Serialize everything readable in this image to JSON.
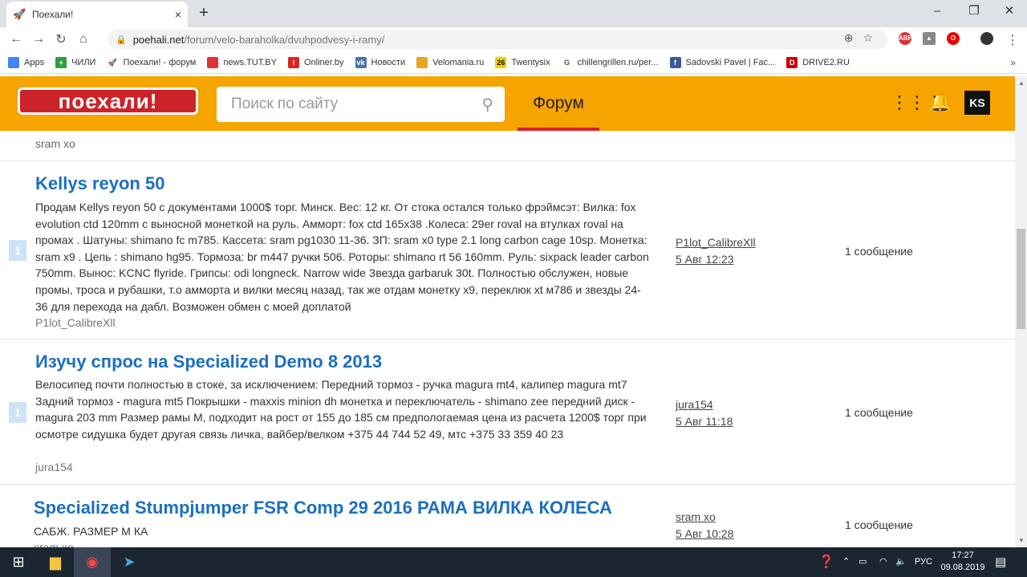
{
  "browser": {
    "tab_title": "Поехали!",
    "tab_close": "×",
    "new_tab": "+",
    "url_domain": "poehali.net",
    "url_path": "/forum/velo-baraholka/dvuhpodvesy-i-ramy/",
    "window_controls": [
      "–",
      "❐",
      "✕"
    ]
  },
  "bookmarks": {
    "items": [
      {
        "label": "Apps",
        "color": "#4285f4",
        "icon": "apps-grid-icon"
      },
      {
        "label": "ЧИЛИ",
        "color": "#2e9e3e",
        "icon": "plus-icon"
      },
      {
        "label": "Поехали! - форум",
        "color": "#e33",
        "icon": "rocket-icon"
      },
      {
        "label": "news.TUT.BY",
        "color": "#d33",
        "icon": "tutby-icon"
      },
      {
        "label": "Onliner.by",
        "color": "#d22",
        "icon": "onliner-icon"
      },
      {
        "label": "Новости",
        "color": "#4a76a8",
        "icon": "vk-icon"
      },
      {
        "label": "Velomania.ru",
        "color": "#e5a622",
        "icon": "velomania-icon"
      },
      {
        "label": "Twentysix",
        "color": "#111",
        "icon": "twentysix-icon"
      },
      {
        "label": "chillengrillen.ru/per...",
        "color": "#555",
        "icon": "chillengrillen-icon"
      },
      {
        "label": "Sadovski Pavel | Fac...",
        "color": "#3b5998",
        "icon": "facebook-icon"
      },
      {
        "label": "DRIVE2.RU",
        "color": "#c00",
        "icon": "drive2-icon"
      }
    ],
    "more": "»"
  },
  "site": {
    "logo": "поехали!",
    "search_placeholder": "Поиск по сайту",
    "forum_tab": "Форум",
    "accent": "#f5a400"
  },
  "content": {
    "prev_author_tail": "sram xo",
    "topics": [
      {
        "title": "Kellys reyon 50",
        "description": "Продам Kellys reyon 50 с документами 1000$ торг. Минск. Вес: 12 кг. От стока остался только фрэймсэт: Вилка: fox evolution ctd 120mm с выносной монеткой на руль. Амморт: fox ctd 165x38 .Колеса: 29er roval на втулках roval на промах . Шатуны: shimano fc m785. Кассета: sram pg1030 11-36. ЗП: sram x0 type 2.1 long carbon cage 10sp. Монетка: sram x9 . Цепь : shimano hg95. Тормоза: br m447 ручки 506. Роторы: shimano rt 56 160mm. Руль: sixpack leader carbon 750mm. Вынос: KCNC flyride. Грипсы: odi longneck. Narrow wide Звезда garbaruk 30t. Полностью обслужен, новые промы, троса и рубашки, т.о амморта и вилки месяц назад, так же отдам монетку x9, переклюк xt м786 и звезды 24-36 для перехода на дабл. Возможен обмен с моей доплатой",
        "author": "P1lot_CalibreXll",
        "badge": "1",
        "last_author": "P1lot_CalibreXll",
        "last_date": "5 Авг 12:23",
        "count": "1 сообщение"
      },
      {
        "title": "Изучу спрос на Specialized Demo 8 2013",
        "description": "Велосипед почти полностью в стоке, за исключением: Передний тормоз - ручка magura mt4, калипер magura mt7 Задний тормоз - magura mt5 Покрышки - maxxis minion dh монетка и переключатель - shimano zee передний диск - magura 203 mm Размер рамы М, подходит на рост от 155 до 185 см предпологаемая цена из расчета 1200$ торг при осмотре сидушка будет другая связь личка, вайбер/велком +375 44 744 52 49, мтс +375 33 359 40 23",
        "author": "jura154",
        "badge": "1",
        "last_author": "jura154",
        "last_date": "5 Авг 11:18",
        "count": "1 сообщение"
      },
      {
        "title": "Specialized Stumpjumper FSR Comp 29 2016 РАМА ВИЛКА КОЛЕСА",
        "description": "САБЖ. РАЗМЕР М КА",
        "author": "sram xo",
        "last_author": "sram xo",
        "last_date": "5 Авг 10:28",
        "count": "1 сообщение"
      }
    ]
  },
  "taskbar": {
    "lang": "РУС",
    "time": "17:27",
    "date": "09.08.2019"
  }
}
